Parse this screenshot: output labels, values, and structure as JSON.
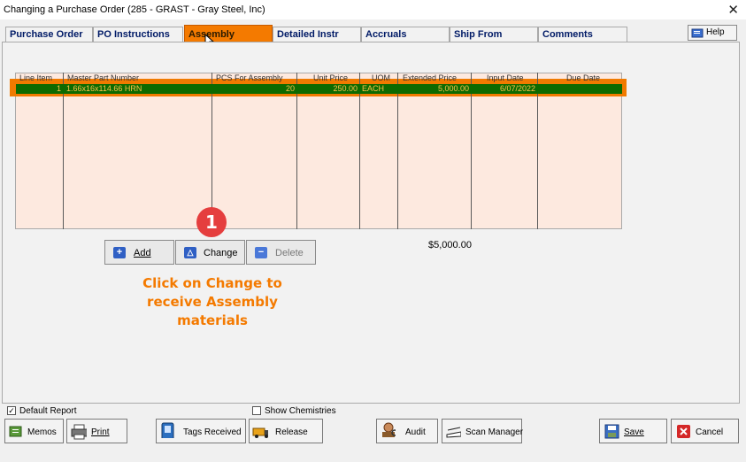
{
  "window": {
    "title": "Changing a Purchase Order  (285 - GRAST - Gray Steel, Inc)",
    "close_glyph": "✕"
  },
  "tabs": [
    {
      "label": "Purchase Order",
      "active": false
    },
    {
      "label": "PO Instructions",
      "active": false
    },
    {
      "label": "Assembly",
      "active": true
    },
    {
      "label": "Detailed Instr",
      "active": false
    },
    {
      "label": "Accruals",
      "active": false
    },
    {
      "label": "Ship From",
      "active": false
    },
    {
      "label": "Comments",
      "active": false
    }
  ],
  "help": {
    "label": "Help",
    "icon": "help-book-icon"
  },
  "grid": {
    "columns": [
      "Line Item",
      "Master Part Number",
      "PCS For Assembly",
      "Unit Price",
      "UOM",
      "Extended Price",
      "Input Date",
      "Due Date"
    ],
    "rows": [
      {
        "line_item": "1",
        "master_part_number": "1.66x16x114.66 HRN",
        "pcs_for_assembly": "20",
        "unit_price": "250.00",
        "uom": "EACH",
        "extended_price": "5,000.00",
        "input_date": "6/07/2022",
        "due_date": ""
      }
    ]
  },
  "actions": {
    "add_label": "Add",
    "change_label": "Change",
    "delete_label": "Delete"
  },
  "total": "$5,000.00",
  "annotation": {
    "step": "1",
    "line1": "Click on Change to",
    "line2": "receive Assembly",
    "line3": "materials"
  },
  "options": {
    "default_report_label": "Default Report",
    "default_report_checked": true,
    "show_chemistries_label": "Show Chemistries",
    "show_chemistries_checked": false
  },
  "bottom_buttons": {
    "memos": "Memos",
    "print": "Print",
    "tags_received": "Tags Received",
    "release": "Release",
    "audit": "Audit",
    "scan_manager": "Scan Manager",
    "save": "Save",
    "cancel": "Cancel"
  },
  "colors": {
    "accent_orange": "#f47a00",
    "selected_row": "#0d6a00",
    "grid_bg": "#fde9df",
    "badge_red": "#e53e3e"
  }
}
